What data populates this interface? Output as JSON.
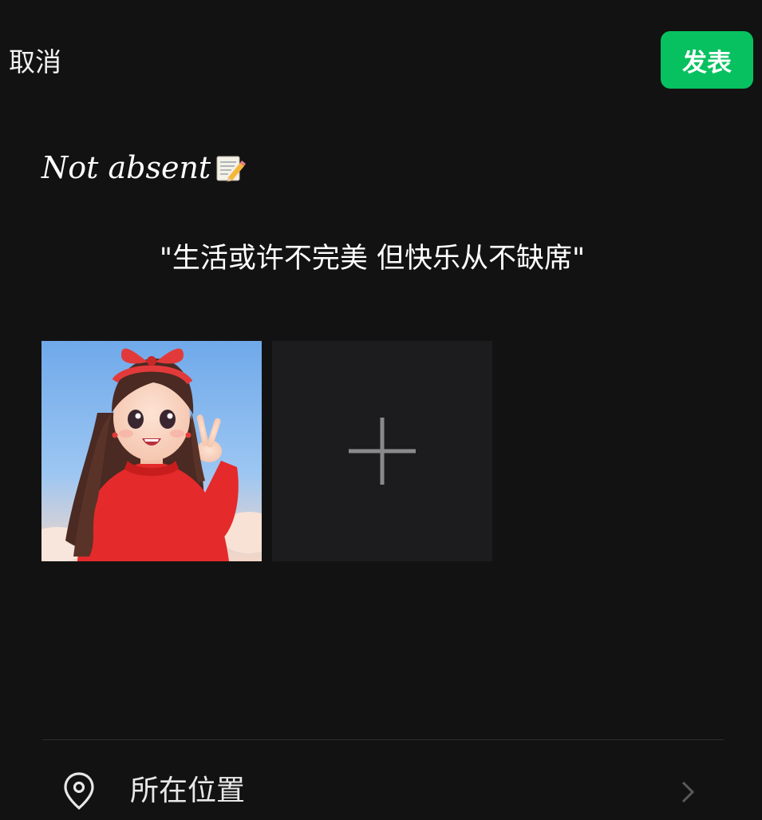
{
  "header": {
    "cancel_label": "取消",
    "publish_label": "发表"
  },
  "post": {
    "headline": "Not absent",
    "headline_emoji": "memo-pencil-icon",
    "quote": "\"生活或许不完美 但快乐从不缺席\""
  },
  "media": {
    "photo_icon": "girl-peace-sign-avatar",
    "add_icon": "plus-icon"
  },
  "location": {
    "label": "所在位置",
    "icon": "location-pin-icon",
    "chevron_icon": "chevron-right-icon"
  },
  "colors": {
    "background": "#121212",
    "accent": "#07C160",
    "add_tile": "#1C1C1E",
    "divider": "#2E2E2E"
  }
}
